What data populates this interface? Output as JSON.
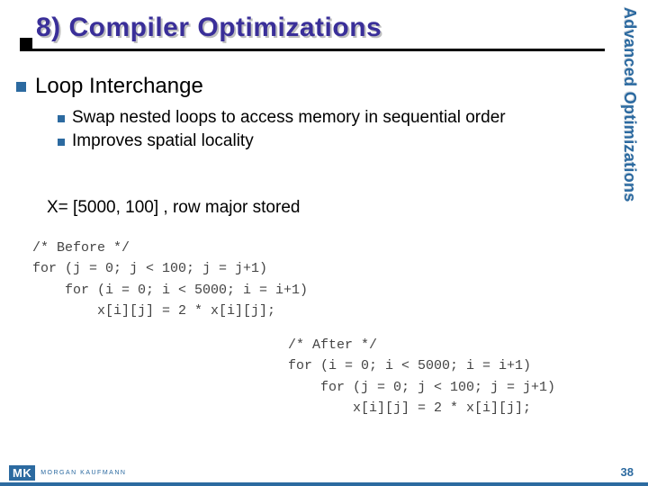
{
  "title": "8) Compiler Optimizations",
  "side_label": "Advanced Optimizations",
  "bullet_main": "Loop Interchange",
  "sub_bullets": [
    "Swap nested loops to access memory in sequential order",
    "Improves spatial locality"
  ],
  "note": "X= [5000, 100] , row major stored",
  "code_before": "/* Before */\nfor (j = 0; j < 100; j = j+1)\n    for (i = 0; i < 5000; i = i+1)\n        x[i][j] = 2 * x[i][j];",
  "code_after": "/* After */\nfor (i = 0; i < 5000; i = i+1)\n    for (j = 0; j < 100; j = j+1)\n        x[i][j] = 2 * x[i][j];",
  "logo_mark": "MK",
  "logo_text": "Morgan Kaufmann",
  "page_number": "38"
}
